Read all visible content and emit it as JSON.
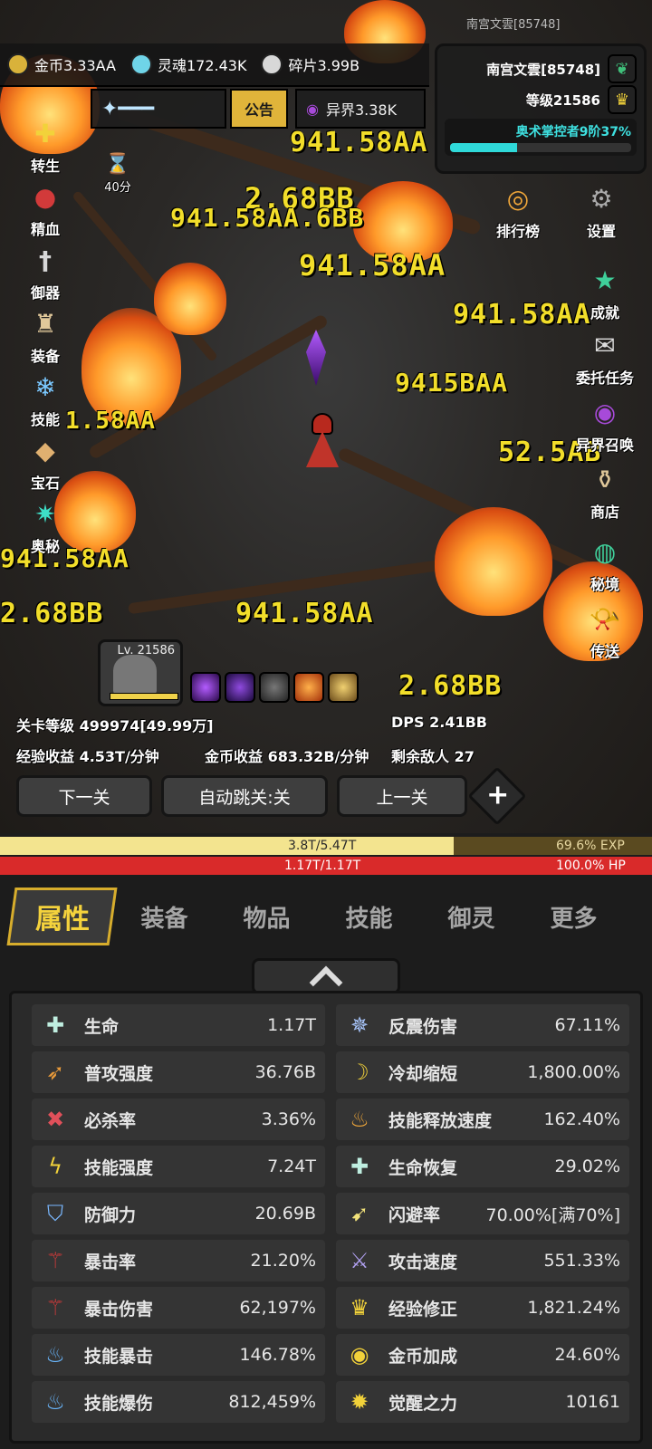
{
  "top": {
    "overlay_name": "南宫文雲[85748]",
    "resources": [
      {
        "icon": "gold-coin-icon",
        "label": "金币3.33AA"
      },
      {
        "icon": "soul-icon",
        "label": "灵魂172.43K"
      },
      {
        "icon": "shard-icon",
        "label": "碎片3.99B"
      }
    ],
    "notice_label": "公告",
    "otherworld_label": "异界3.38K",
    "timer_label": "40分"
  },
  "profile": {
    "name": "南宫文雲[85748]",
    "level": "等级21586",
    "arcane": "奥术掌控者9阶37%",
    "arcane_progress": 0.37
  },
  "left_menu": [
    {
      "label": "转生",
      "icon": "rebirth-icon"
    },
    {
      "label": "精血",
      "icon": "blood-icon"
    },
    {
      "label": "御器",
      "icon": "sword-icon"
    },
    {
      "label": "装备",
      "icon": "helmet-icon"
    },
    {
      "label": "技能",
      "icon": "ice-crystal-icon"
    },
    {
      "label": "宝石",
      "icon": "gem-bag-icon"
    },
    {
      "label": "奥秘",
      "icon": "arcane-star-icon"
    }
  ],
  "right_menu": [
    {
      "label": "排行榜",
      "icon": "ranking-icon"
    },
    {
      "label": "设置",
      "icon": "gear-icon"
    },
    {
      "label": "成就",
      "icon": "achievement-star-icon"
    },
    {
      "label": "委托任务",
      "icon": "quest-letter-icon"
    },
    {
      "label": "异界召唤",
      "icon": "portal-icon"
    },
    {
      "label": "商店",
      "icon": "shop-icon"
    },
    {
      "label": "秘境",
      "icon": "secret-realm-icon"
    },
    {
      "label": "传送",
      "icon": "teleport-horn-icon"
    }
  ],
  "damage_numbers": [
    "941.58AA",
    "2.68BB",
    "941.58AA.6BB",
    "941.58AA",
    "941.58AA",
    "9415BAA",
    "1.58AA",
    "52.5AB",
    "941.58AA",
    "2.68BB",
    "941.58AA",
    "2.68BB"
  ],
  "pet": {
    "level": "Lv. 21586",
    "hp_fraction": 1.0
  },
  "stage": {
    "level": "关卡等级 499974[49.99万]",
    "dps": "DPS  2.41BB",
    "exp_rate": "经验收益 4.53T/分钟",
    "gold_rate": "金币收益 683.32B/分钟",
    "enemies": "剩余敌人 27"
  },
  "nav": {
    "next": "下一关",
    "auto": "自动跳关:关",
    "prev": "上一关",
    "plus": "+"
  },
  "exp": {
    "text": "3.8T/5.47T",
    "percent": "69.6% EXP",
    "fraction": 0.696
  },
  "hp": {
    "text": "1.17T/1.17T",
    "percent": "100.0%  HP",
    "fraction": 1.0
  },
  "tabs": [
    "属性",
    "装备",
    "物品",
    "技能",
    "御灵",
    "更多"
  ],
  "stats": [
    {
      "name": "生命",
      "value": "1.17T",
      "icon": "life-cross-icon"
    },
    {
      "name": "反震伤害",
      "value": "67.11%",
      "icon": "reflect-burst-icon"
    },
    {
      "name": "普攻强度",
      "value": "36.76B",
      "icon": "attack-feather-icon"
    },
    {
      "name": "冷却缩短",
      "value": "1,800.00%",
      "icon": "cooldown-moon-icon"
    },
    {
      "name": "必杀率",
      "value": "3.36%",
      "icon": "kill-rate-icon"
    },
    {
      "name": "技能释放速度",
      "value": "162.40%",
      "icon": "cast-speed-flame-icon"
    },
    {
      "name": "技能强度",
      "value": "7.24T",
      "icon": "lightning-icon"
    },
    {
      "name": "生命恢复",
      "value": "29.02%",
      "icon": "regen-cross-icon"
    },
    {
      "name": "防御力",
      "value": "20.69B",
      "icon": "shield-icon"
    },
    {
      "name": "闪避率",
      "value": "70.00%[满70%]",
      "icon": "dodge-boot-icon"
    },
    {
      "name": "暴击率",
      "value": "21.20%",
      "icon": "crit-claw-icon"
    },
    {
      "name": "攻击速度",
      "value": "551.33%",
      "icon": "crossed-swords-icon"
    },
    {
      "name": "暴击伤害",
      "value": "62,197%",
      "icon": "crit-damage-claw-icon"
    },
    {
      "name": "经验修正",
      "value": "1,821.24%",
      "icon": "crown-icon"
    },
    {
      "name": "技能暴击",
      "value": "146.78%",
      "icon": "skill-crit-flame-icon"
    },
    {
      "name": "金币加成",
      "value": "24.60%",
      "icon": "gold-coin-icon"
    },
    {
      "name": "技能爆伤",
      "value": "812,459%",
      "icon": "skill-burst-flame-icon"
    },
    {
      "name": "觉醒之力",
      "value": "10161",
      "icon": "awakening-icon"
    }
  ]
}
